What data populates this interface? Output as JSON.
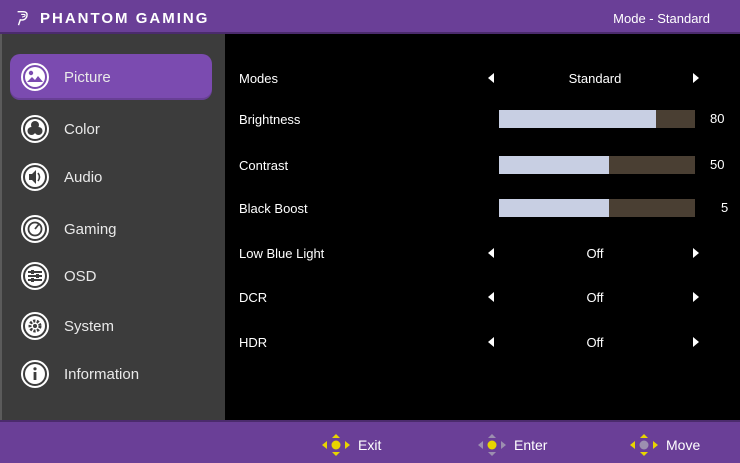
{
  "header": {
    "brand": "PHANTOM GAMING",
    "mode_status": "Mode - Standard"
  },
  "sidebar": {
    "items": [
      {
        "label": "Picture",
        "icon": "picture-icon",
        "active": true
      },
      {
        "label": "Color",
        "icon": "color-icon",
        "active": false
      },
      {
        "label": "Audio",
        "icon": "audio-icon",
        "active": false
      },
      {
        "label": "Gaming",
        "icon": "gaming-icon",
        "active": false
      },
      {
        "label": "OSD",
        "icon": "osd-icon",
        "active": false
      },
      {
        "label": "System",
        "icon": "system-icon",
        "active": false
      },
      {
        "label": "Information",
        "icon": "information-icon",
        "active": false
      }
    ]
  },
  "settings": {
    "modes": {
      "label": "Modes",
      "value": "Standard"
    },
    "brightness": {
      "label": "Brightness",
      "value": "80",
      "level": 0.8
    },
    "contrast": {
      "label": "Contrast",
      "value": "50",
      "level": 0.56
    },
    "black_boost": {
      "label": "Black Boost",
      "value": "5",
      "level": 0.56
    },
    "low_blue_light": {
      "label": "Low Blue Light",
      "value": "Off"
    },
    "dcr": {
      "label": "DCR",
      "value": "Off"
    },
    "hdr": {
      "label": "HDR",
      "value": "Off"
    }
  },
  "footer": {
    "exit": "Exit",
    "enter": "Enter",
    "move": "Move"
  },
  "colors": {
    "header_bg": "#6a3f97",
    "active_bg": "#7b4bb0",
    "bar_fill": "#c8cfe3",
    "bar_track": "#4a3f33",
    "joystick_yellow": "#e8d400"
  }
}
